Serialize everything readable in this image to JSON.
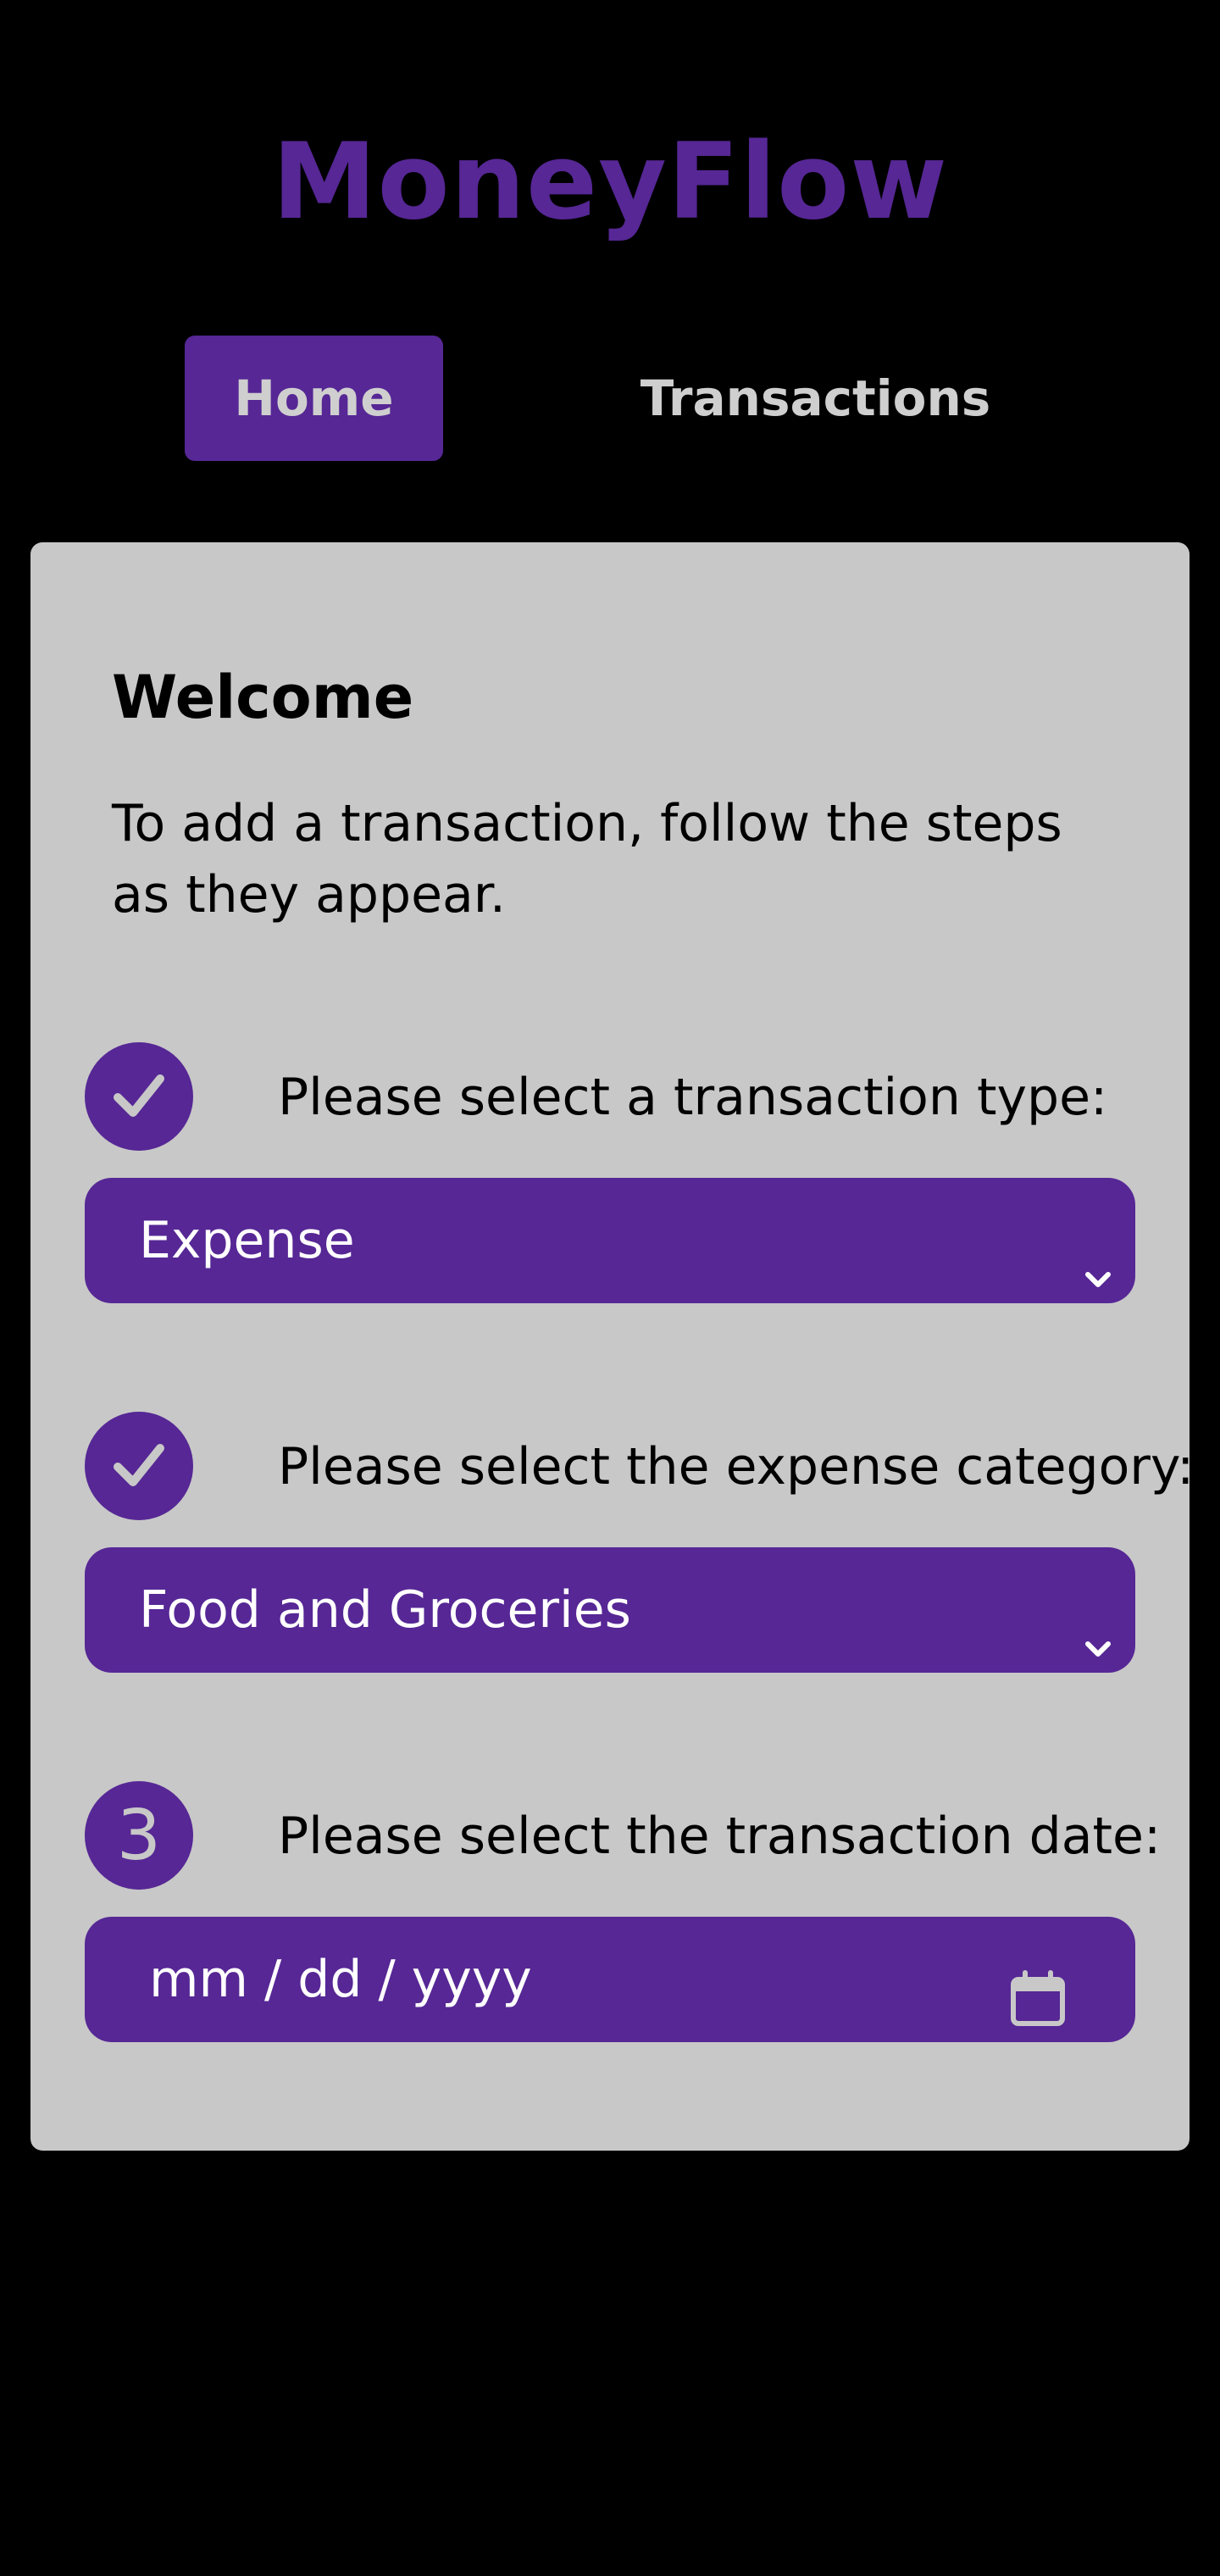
{
  "app": {
    "title": "MoneyFlow"
  },
  "nav": {
    "tabs": [
      {
        "label": "Home",
        "active": true
      },
      {
        "label": "Transactions",
        "active": false
      }
    ]
  },
  "card": {
    "title": "Welcome",
    "intro": "To add a transaction, follow the steps as they appear.",
    "steps": [
      {
        "badge": "check-icon",
        "label": "Please select a transaction type:",
        "control_type": "select",
        "value": "Expense"
      },
      {
        "badge": "check-icon",
        "label": "Please select the expense category:",
        "control_type": "select",
        "value": "Food and Groceries"
      },
      {
        "badge_text": "3",
        "label": "Please select the transaction date:",
        "control_type": "date",
        "placeholder": "mm / dd / yyyy",
        "icon": "calendar-icon"
      }
    ]
  },
  "colors": {
    "background": "#000000",
    "accent": "#562795",
    "card": "#c8c8c8",
    "nav_text": "#cfcfcf",
    "control_text": "#ffffff"
  }
}
